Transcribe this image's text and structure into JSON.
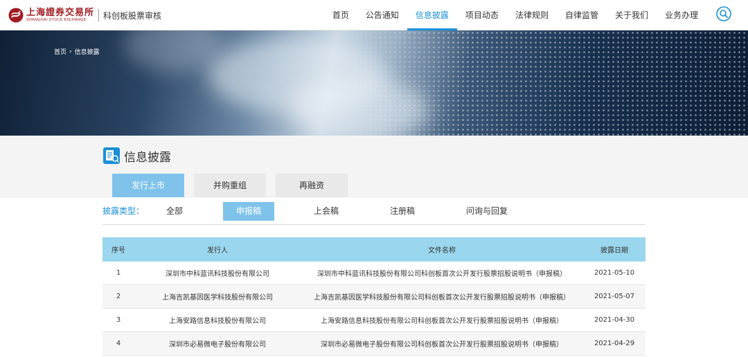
{
  "header": {
    "logo_cn": "上海證券交易所",
    "logo_en": "SHANGHAI STOCK EXCHANGE",
    "subtitle": "科创板股票审核",
    "nav": [
      "首页",
      "公告通知",
      "信息披露",
      "项目动态",
      "法律规则",
      "自律监管",
      "关于我们",
      "业务办理"
    ],
    "active_nav": "信息披露",
    "search_icon": "search-icon"
  },
  "breadcrumb": {
    "home": "首页",
    "separator": "›",
    "current": "信息披露"
  },
  "section": {
    "title": "信息披露",
    "icon": "document-icon"
  },
  "tabs": [
    {
      "label": "发行上市",
      "active": true
    },
    {
      "label": "并购重组",
      "active": false
    },
    {
      "label": "再融资",
      "active": false
    }
  ],
  "filter": {
    "label": "披露类型：",
    "options": [
      "全部",
      "申报稿",
      "上会稿",
      "注册稿",
      "问询与回复"
    ],
    "active": "申报稿"
  },
  "table": {
    "columns": [
      "序号",
      "发行人",
      "文件名称",
      "披露日期"
    ],
    "rows": [
      [
        "1",
        "深圳市中科蓝讯科技股份有限公司",
        "深圳市中科蓝讯科技股份有限公司科创板首次公开发行股票招股说明书（申报稿）",
        "2021-05-10"
      ],
      [
        "2",
        "上海吉凯基因医学科技股份有限公司",
        "上海吉凯基因医学科技股份有限公司科创板首次公开发行股票招股说明书（申报稿）",
        "2021-05-07"
      ],
      [
        "3",
        "上海安路信息科技股份有限公司",
        "上海安路信息科技股份有限公司科创板首次公开发行股票招股说明书（申报稿）",
        "2021-04-30"
      ],
      [
        "4",
        "深圳市必易微电子股份有限公司",
        "深圳市必易微电子股份有限公司科创板首次公开发行股票招股说明书（申报稿）",
        "2021-04-29"
      ]
    ]
  },
  "colors": {
    "accent": "#1a8fd6",
    "active_tab": "#7fc3ea",
    "table_header": "#9ad6ee",
    "brand_red": "#a01c24"
  }
}
